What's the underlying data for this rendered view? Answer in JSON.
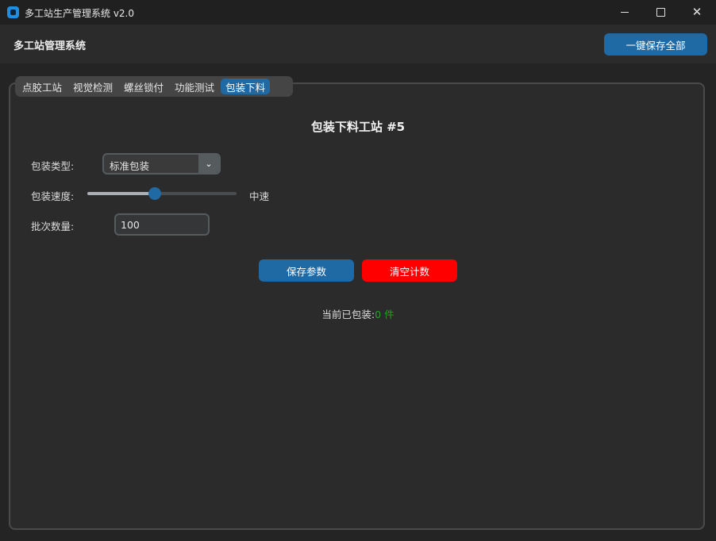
{
  "window": {
    "title": "多工站生产管理系统 v2.0"
  },
  "header": {
    "title": "多工站管理系统",
    "save_all_label": "一键保存全部"
  },
  "tabs": [
    {
      "label": "点胶工站",
      "active": false
    },
    {
      "label": "视觉检测",
      "active": false
    },
    {
      "label": "螺丝锁付",
      "active": false
    },
    {
      "label": "功能测试",
      "active": false
    },
    {
      "label": "包装下料",
      "active": true
    }
  ],
  "station": {
    "title": "包装下料工站 #5",
    "package_type_label": "包装类型:",
    "package_type_value": "标准包装",
    "speed_label": "包装速度:",
    "speed_value_label": "中速",
    "speed_level": 0.45,
    "batch_label": "批次数量:",
    "batch_value": "100",
    "save_button": "保存参数",
    "clear_button": "清空计数",
    "count_prefix": "当前已包装:",
    "count_value": "0 件"
  },
  "colors": {
    "accent": "#1f6aa5",
    "danger": "#ff0000",
    "count": "#1fa61f"
  }
}
